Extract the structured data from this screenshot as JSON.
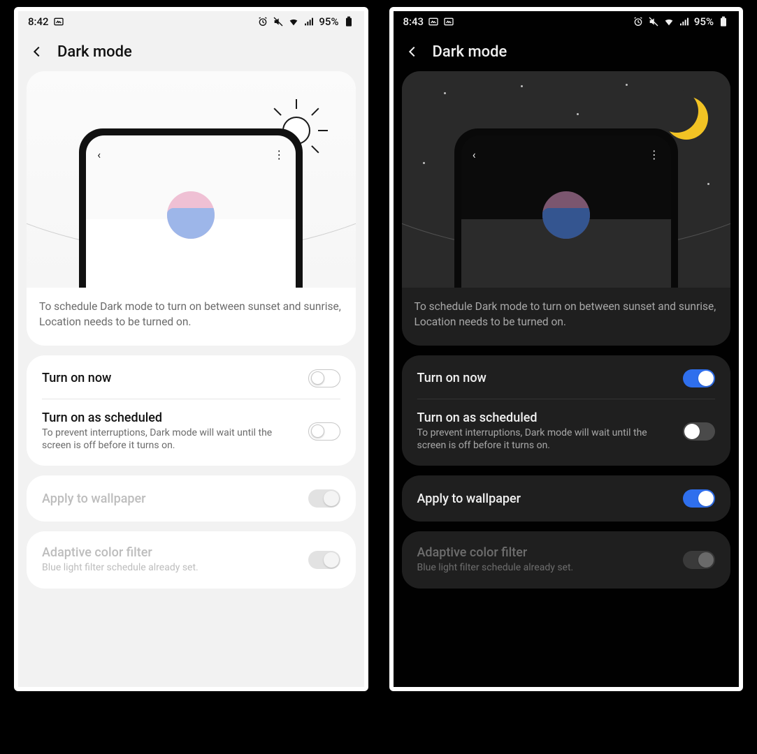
{
  "light": {
    "status": {
      "time": "8:42",
      "battery": "95%"
    },
    "title": "Dark mode",
    "hero_text": "To schedule Dark mode to turn on between sunset and sunrise, Location needs to be turned on.",
    "rows": {
      "now": {
        "title": "Turn on now",
        "on": false,
        "disabled": false
      },
      "schedule": {
        "title": "Turn on as scheduled",
        "sub": "To prevent interruptions, Dark mode will wait until the screen is off before it turns on.",
        "on": false,
        "disabled": false
      },
      "wallpaper": {
        "title": "Apply to wallpaper",
        "on": true,
        "disabled": true
      },
      "filter": {
        "title": "Adaptive color filter",
        "sub": "Blue light filter schedule already set.",
        "on": true,
        "disabled": true
      }
    }
  },
  "dark": {
    "status": {
      "time": "8:43",
      "battery": "95%"
    },
    "title": "Dark mode",
    "hero_text": "To schedule Dark mode to turn on between sunset and sunrise, Location needs to be turned on.",
    "rows": {
      "now": {
        "title": "Turn on now",
        "on": true,
        "disabled": false
      },
      "schedule": {
        "title": "Turn on as scheduled",
        "sub": "To prevent interruptions, Dark mode will wait until the screen is off before it turns on.",
        "on": false,
        "disabled": false
      },
      "wallpaper": {
        "title": "Apply to wallpaper",
        "on": true,
        "disabled": false
      },
      "filter": {
        "title": "Adaptive color filter",
        "sub": "Blue light filter schedule already set.",
        "on": true,
        "disabled": true
      }
    }
  }
}
